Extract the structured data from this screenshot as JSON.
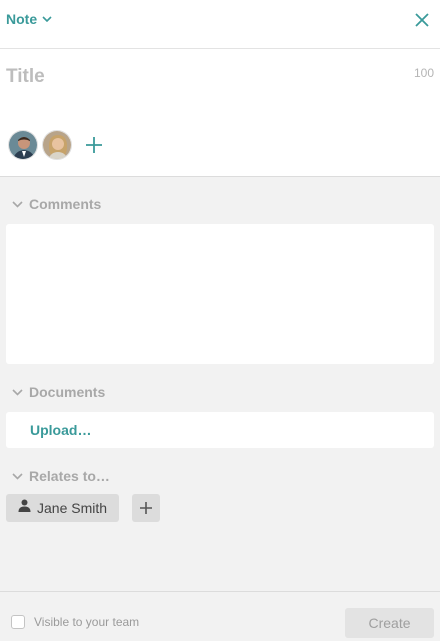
{
  "header": {
    "type_label": "Note",
    "type_chevron_icon": "chevron-down-icon",
    "close_icon": "close-icon"
  },
  "title_field": {
    "placeholder": "Title",
    "value": "",
    "char_remaining": "100"
  },
  "participants": {
    "avatars": [
      "avatar-man",
      "avatar-woman"
    ],
    "add_icon": "plus-icon"
  },
  "sections": {
    "comments": {
      "label": "Comments"
    },
    "documents": {
      "label": "Documents",
      "upload_label": "Upload…"
    },
    "relates_to": {
      "label": "Relates to…",
      "chip_label": "Jane Smith",
      "chip_icon": "person-icon",
      "add_icon": "plus-icon"
    }
  },
  "footer": {
    "visible_label": "Visible to your team",
    "visible_checked": false,
    "create_label": "Create"
  },
  "colors": {
    "accent": "#3a9a9a",
    "muted_text": "#a8a8a8",
    "panel_bg": "#f2f2f2"
  }
}
